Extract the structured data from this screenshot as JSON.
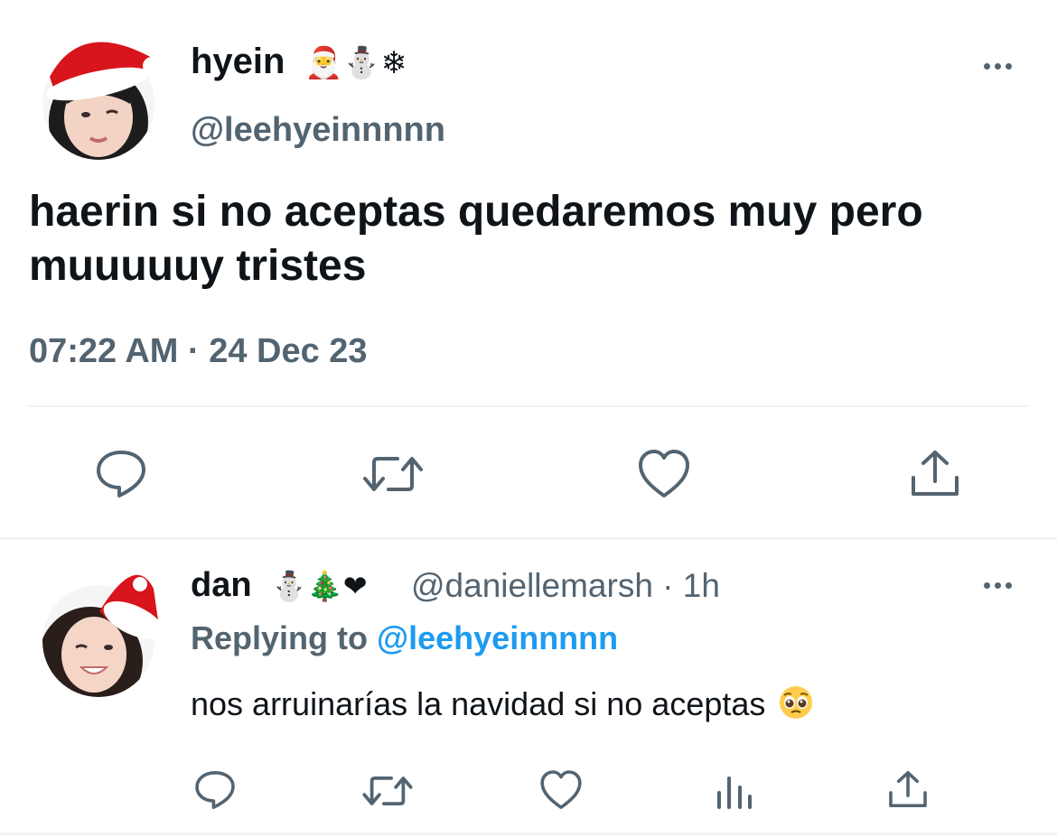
{
  "main_tweet": {
    "display_name": "hyein",
    "name_emojis": "🎅⛄❄",
    "handle": "@leehyeinnnnn",
    "text": "haerin si no aceptas quedaremos muy pero muuuuuy tristes",
    "timestamp": "07:22 AM · 24 Dec 23"
  },
  "reply_tweet": {
    "display_name": "dan",
    "name_emojis": "⛄🎄❤",
    "handle_time": "@daniellemarsh · 1h",
    "replying_prefix": "Replying to",
    "replying_mention": "@leehyeinnnnn",
    "text": "nos arruinarías la navidad si no aceptas"
  },
  "icons": {
    "main_actions": [
      "reply-icon",
      "retweet-icon",
      "like-icon",
      "share-icon"
    ],
    "reply_actions": [
      "reply-icon",
      "retweet-icon",
      "like-icon",
      "analytics-icon",
      "share-icon"
    ],
    "more": "more-icon",
    "reply_emoji": "pleading-face-emoji"
  },
  "colors": {
    "text_primary": "#0f1419",
    "text_secondary": "#536471",
    "link": "#1d9bf0",
    "divider": "#eff3f4",
    "icon": "#536471"
  }
}
